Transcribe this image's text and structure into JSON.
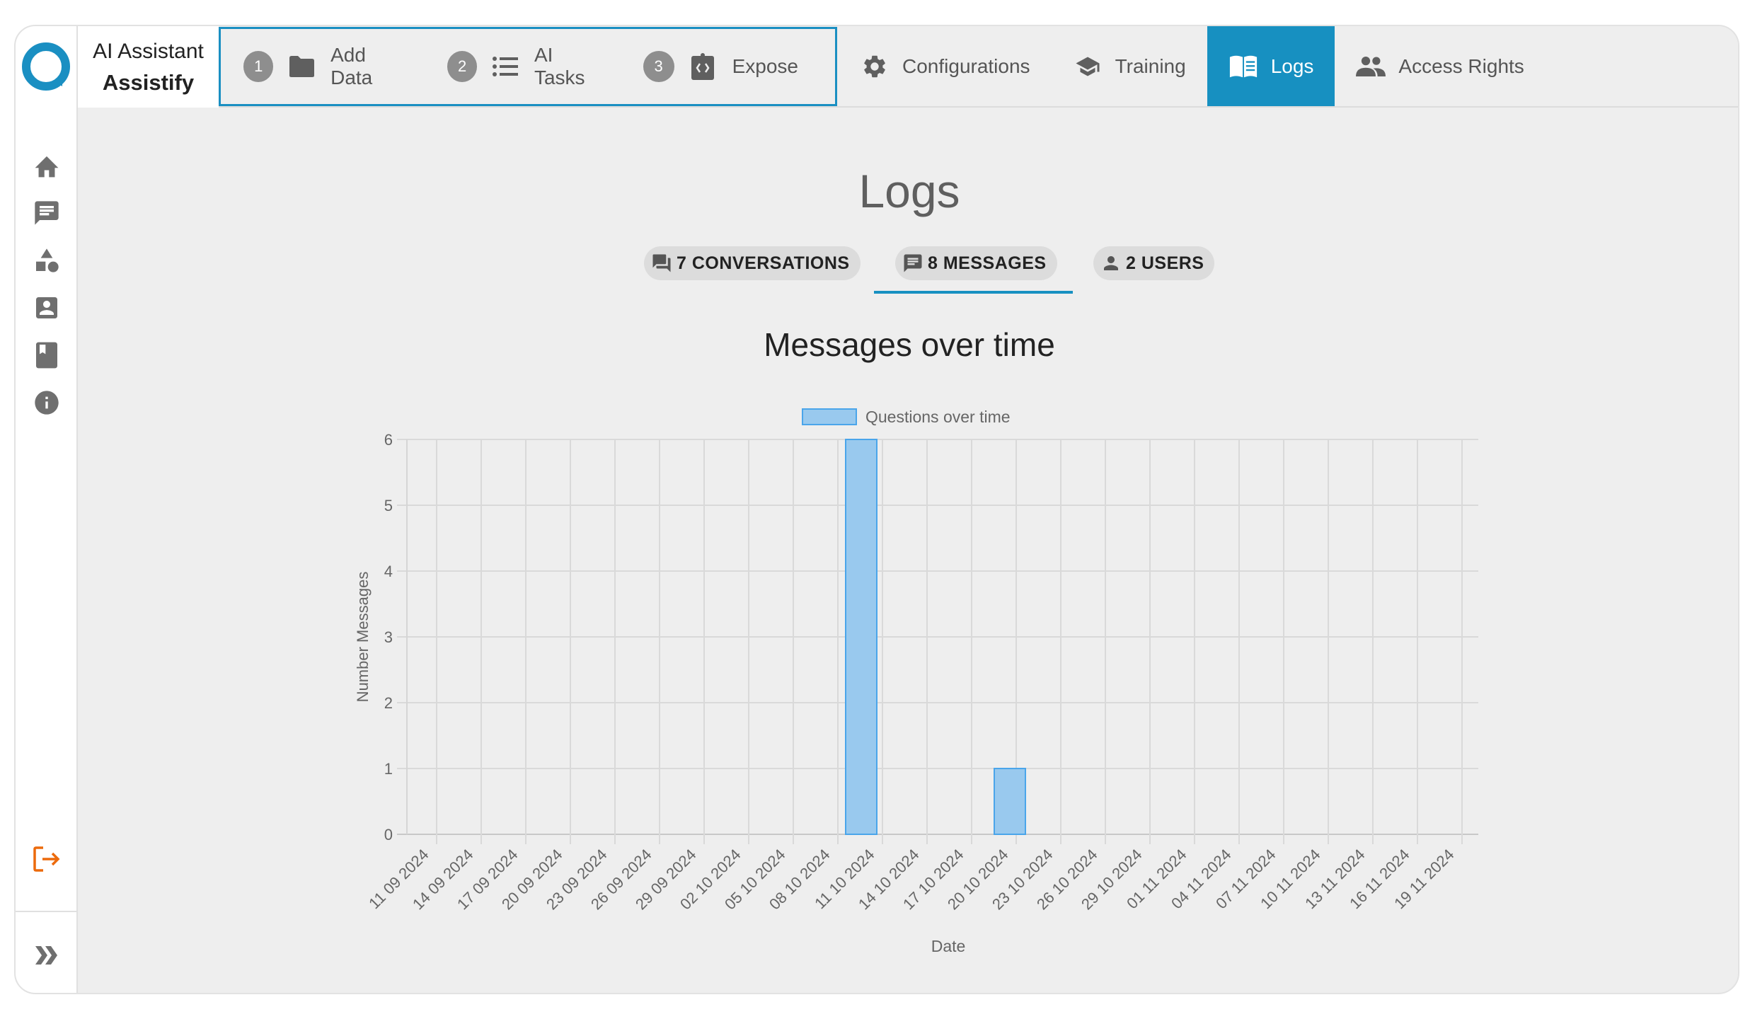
{
  "header": {
    "app_title": "AI Assistant",
    "app_name": "Assistify",
    "steps": [
      {
        "number": "1",
        "label": "Add Data",
        "icon": "folder-icon"
      },
      {
        "number": "2",
        "label": "AI Tasks",
        "icon": "list-icon"
      },
      {
        "number": "3",
        "label": "Expose",
        "icon": "code-clipboard-icon"
      }
    ],
    "tabs": [
      {
        "label": "Configurations",
        "icon": "gear-icon",
        "active": false
      },
      {
        "label": "Training",
        "icon": "graduation-cap-icon",
        "active": false
      },
      {
        "label": "Logs",
        "icon": "book-icon",
        "active": true
      },
      {
        "label": "Access Rights",
        "icon": "people-icon",
        "active": false
      }
    ]
  },
  "sidebar": {
    "items": [
      {
        "icon": "home-icon"
      },
      {
        "icon": "chat-icon"
      },
      {
        "icon": "shapes-icon"
      },
      {
        "icon": "contact-icon"
      },
      {
        "icon": "bookmark-book-icon"
      },
      {
        "icon": "info-icon"
      }
    ],
    "logout_icon": "logout-icon",
    "expand_icon": "double-chevron-right-icon"
  },
  "main": {
    "title": "Logs",
    "chips": [
      {
        "label": "7 CONVERSATIONS",
        "icon": "forum-icon",
        "active": false
      },
      {
        "label": "8 MESSAGES",
        "icon": "message-icon",
        "active": true
      },
      {
        "label": "2 USERS",
        "icon": "person-icon",
        "active": false
      }
    ],
    "chart_heading": "Messages over time"
  },
  "colors": {
    "accent": "#1790c1",
    "bar_fill": "#99c9ee",
    "bar_border": "#4aa5ea",
    "logout": "#ec6a0c"
  },
  "chart_data": {
    "type": "bar",
    "title": "Messages over time",
    "legend": [
      "Questions over time"
    ],
    "legend_position": "top",
    "xlabel": "Date",
    "ylabel": "Number Messages",
    "ylim": [
      0,
      6
    ],
    "yticks": [
      "0",
      "1",
      "2",
      "3",
      "4",
      "5",
      "6"
    ],
    "grid": true,
    "x_tick_labels": [
      "11 09 2024",
      "14 09 2024",
      "17 09 2024",
      "20 09 2024",
      "23 09 2024",
      "26 09 2024",
      "29 09 2024",
      "02 10 2024",
      "05 10 2024",
      "08 10 2024",
      "11 10 2024",
      "14 10 2024",
      "17 10 2024",
      "20 10 2024",
      "23 10 2024",
      "26 10 2024",
      "29 10 2024",
      "01 11 2024",
      "04 11 2024",
      "07 11 2024",
      "10 11 2024",
      "13 11 2024",
      "16 11 2024",
      "19 11 2024"
    ],
    "x_range": [
      "09 09 2024",
      "22 11 2024"
    ],
    "series": [
      {
        "name": "Questions over time",
        "points": [
          {
            "date": "10 10 2024",
            "value": 6
          },
          {
            "date": "20 10 2024",
            "value": 1
          }
        ]
      }
    ]
  }
}
